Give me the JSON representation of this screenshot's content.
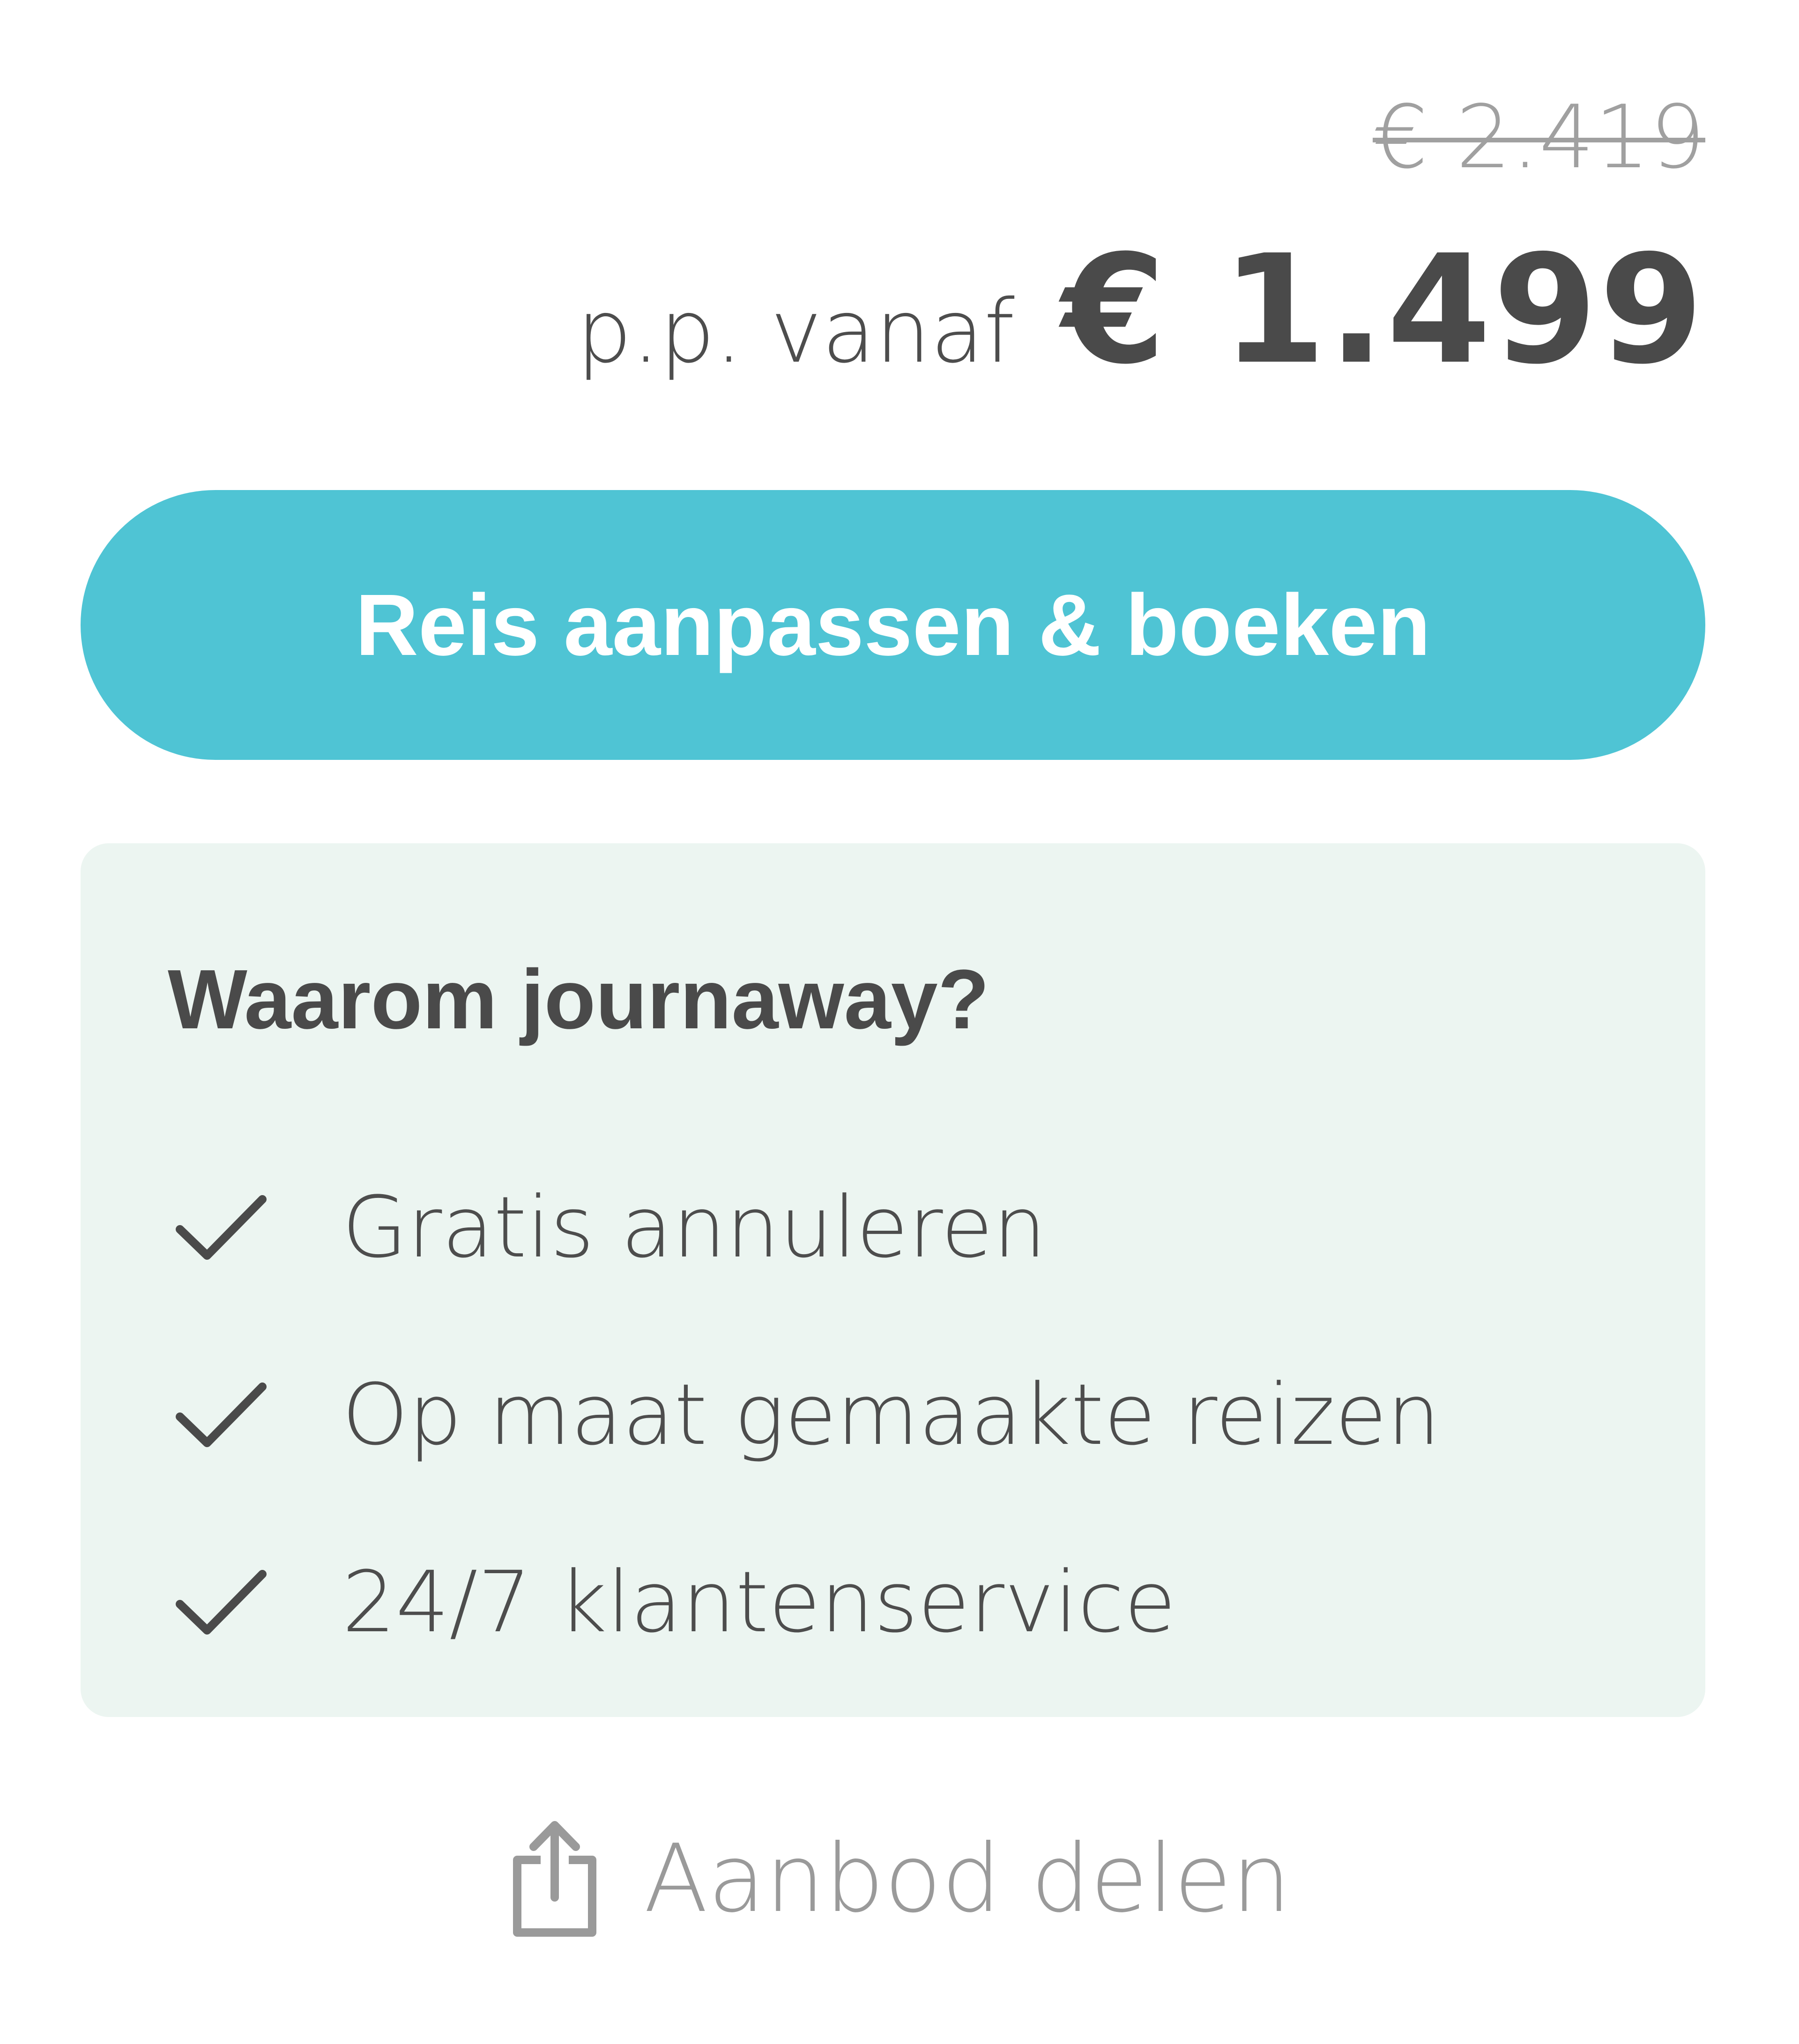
{
  "pricing": {
    "old_price": "€ 2.419",
    "per_person_label": "p.p. vanaf",
    "new_price": "€ 1.499"
  },
  "book_button": {
    "label": "Reis aanpassen & boeken",
    "color": "#4fc4d4"
  },
  "why_box": {
    "title": "Waarom journaway?",
    "background": "#ecf5f1",
    "items": [
      {
        "icon": "checkmark-icon",
        "text": "Gratis annuleren"
      },
      {
        "icon": "checkmark-icon",
        "text": "Op maat gemaakte reizen"
      },
      {
        "icon": "checkmark-icon",
        "text": "24/7 klantenservice"
      }
    ]
  },
  "share": {
    "icon": "share-icon",
    "label": "Aanbod delen"
  }
}
